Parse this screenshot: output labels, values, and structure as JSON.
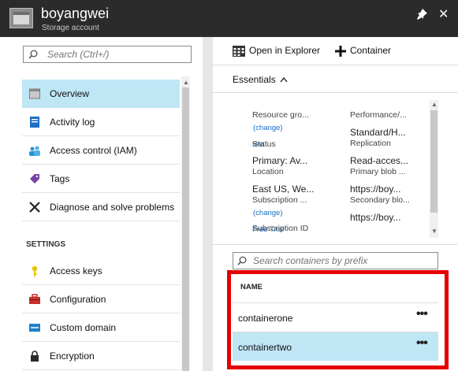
{
  "header": {
    "title": "boyangwei",
    "subtitle": "Storage account",
    "pin_icon": "pin-icon",
    "close_icon": "close-icon",
    "close_glyph": "✕"
  },
  "left_panel": {
    "search_placeholder": "Search (Ctrl+/)",
    "items": [
      {
        "label": "Overview",
        "icon": "overview-icon",
        "selected": true
      },
      {
        "label": "Activity log",
        "icon": "activity-log-icon"
      },
      {
        "label": "Access control (IAM)",
        "icon": "people-icon"
      },
      {
        "label": "Tags",
        "icon": "tag-icon"
      },
      {
        "label": "Diagnose and solve problems",
        "icon": "wrench-icon"
      }
    ],
    "settings_label": "SETTINGS",
    "settings_items": [
      {
        "label": "Access keys",
        "icon": "key-icon"
      },
      {
        "label": "Configuration",
        "icon": "toolbox-icon"
      },
      {
        "label": "Custom domain",
        "icon": "domain-icon"
      },
      {
        "label": "Encryption",
        "icon": "lock-icon"
      }
    ]
  },
  "toolbar": {
    "open_explorer_label": "Open in Explorer",
    "container_label": "Container"
  },
  "essentials": {
    "label": "Essentials",
    "left_props": {
      "resource_group_key": "Resource gro...",
      "resource_group_link": "(change)",
      "resource_group_val": "test",
      "status_key": "Status",
      "status_val": "Primary: Av...",
      "location_key": "Location",
      "location_val": "East US, We...",
      "subscription_key": "Subscription ...",
      "subscription_link": "(change)",
      "subscription_val": "Free Trial",
      "subscription_id_key": "Subscription ID"
    },
    "right_props": {
      "performance_key": "Performance/...",
      "performance_val": "Standard/H...",
      "replication_key": "Replication",
      "replication_val": "Read-acces...",
      "primary_blob_key": "Primary blob ...",
      "primary_blob_val": "https://boy...",
      "secondary_blob_key": "Secondary blo...",
      "secondary_blob_val": "https://boy..."
    }
  },
  "containers": {
    "search_placeholder": "Search containers by prefix",
    "column_name": "NAME",
    "rows": [
      {
        "name": "containerone",
        "more": "•••"
      },
      {
        "name": "containertwo",
        "more": "•••",
        "selected": true
      }
    ]
  },
  "colors": {
    "header_bg": "#2b2b2b",
    "selected_bg": "#bfe6f5",
    "link": "#1a6fc0",
    "highlight": "#e60000"
  }
}
